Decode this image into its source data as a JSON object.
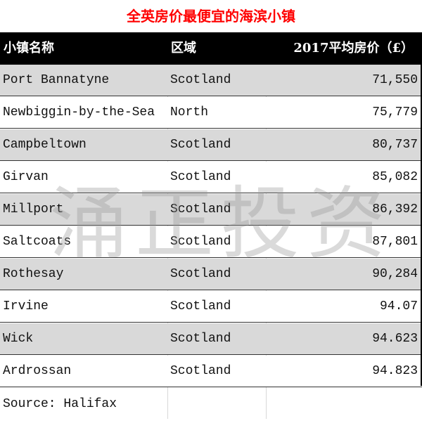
{
  "title": "全英房价最便宜的海滨小镇",
  "header": {
    "col_town": "小镇名称",
    "col_region": "区域",
    "col_price": "2017平均房价（£）"
  },
  "rows": [
    {
      "town": "Port Bannatyne",
      "region": "Scotland",
      "price": "71,550"
    },
    {
      "town": "Newbiggin-by-the-Sea",
      "region": "North",
      "price": "75,779"
    },
    {
      "town": "Campbeltown",
      "region": "Scotland",
      "price": "80,737"
    },
    {
      "town": "Girvan",
      "region": "Scotland",
      "price": "85,082"
    },
    {
      "town": "Millport",
      "region": "Scotland",
      "price": "86,392"
    },
    {
      "town": "Saltcoats",
      "region": "Scotland",
      "price": "87,801"
    },
    {
      "town": "Rothesay",
      "region": "Scotland",
      "price": "90,284"
    },
    {
      "town": "Irvine",
      "region": "Scotland",
      "price": "94.07"
    },
    {
      "town": "Wick",
      "region": "Scotland",
      "price": "94.623"
    },
    {
      "town": "Ardrossan",
      "region": "Scotland",
      "price": "94.823"
    }
  ],
  "source": "Source:  Halifax",
  "watermark": "涌正投资",
  "colors": {
    "title": "#ff0000",
    "header_bg": "#000000",
    "band": "#d9d9d9"
  }
}
